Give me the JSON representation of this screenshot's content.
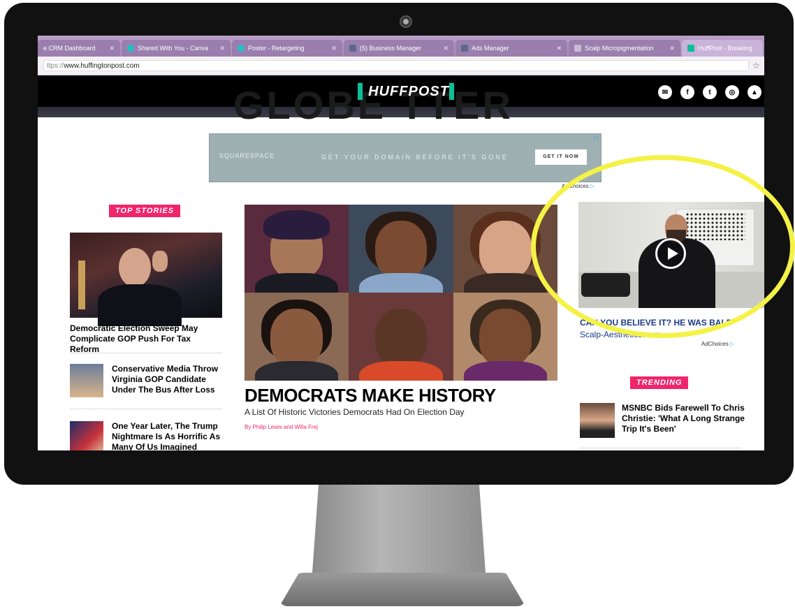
{
  "browser": {
    "tabs": [
      {
        "label": "e CRM Dashboard",
        "favicon_color": "#9a7fae"
      },
      {
        "label": "Shared With You - Canva",
        "favicon_color": "#21c0c9"
      },
      {
        "label": "Poster - Retargeting",
        "favicon_color": "#21c0c9"
      },
      {
        "label": "(5) Business Manager",
        "favicon_color": "#5a6a8c"
      },
      {
        "label": "Ads Manager",
        "favicon_color": "#5a6a8c"
      },
      {
        "label": "Scalp Micropigmentation",
        "favicon_color": "#c7b8d3"
      },
      {
        "label": "HuffPost - Breaking",
        "favicon_color": "#0dbe98"
      }
    ],
    "url_protocol": "ttps://",
    "url_host": "www.huffingtonpost.com",
    "bookmark_icon": "star-icon"
  },
  "header": {
    "background_word": "GLOBE TTER",
    "logo": "HUFFPOST",
    "social": [
      {
        "name": "email-icon",
        "glyph": "✉"
      },
      {
        "name": "facebook-icon",
        "glyph": "f"
      },
      {
        "name": "twitter-icon",
        "glyph": "t"
      },
      {
        "name": "instagram-icon",
        "glyph": "◎"
      },
      {
        "name": "more-icon",
        "glyph": "▲"
      }
    ]
  },
  "ad_banner": {
    "brand": "SQUARESPACE",
    "tagline": "GET YOUR DOMAIN BEFORE IT'S GONE",
    "cta": "GET IT NOW",
    "adchoices": "AdChoices"
  },
  "top_stories": {
    "label": "TOP STORIES",
    "lead_headline": "Democratic Election Sweep May Complicate GOP Push For Tax Reform",
    "items": [
      {
        "headline": "Conservative Media Throw Virginia GOP Candidate Under The Bus After Loss"
      },
      {
        "headline": "One Year Later, The Trump Nightmare Is As Horrific As Many Of Us Imagined"
      }
    ]
  },
  "main_story": {
    "headline": "DEMOCRATS MAKE HISTORY",
    "subhead": "A List Of Historic Victories Democrats Had On Election Day",
    "byline": "By Philip Lewis and Willa Frej"
  },
  "video_ad": {
    "title": "CAN YOU BELIEVE IT? HE WAS BALD",
    "domain": "Scalp-Aesthetics.com",
    "adchoices": "AdChoices",
    "play_icon": "play-icon"
  },
  "trending": {
    "label": "TRENDING",
    "items": [
      {
        "headline": "MSNBC Bids Farewell To Chris Christie: 'What A Long Strange Trip It's Been'"
      }
    ]
  },
  "colors": {
    "accent_pink": "#f0256b",
    "huffpost_green": "#0dbe98",
    "highlight_yellow": "#f4f247",
    "tab_purple": "#a88db9"
  }
}
